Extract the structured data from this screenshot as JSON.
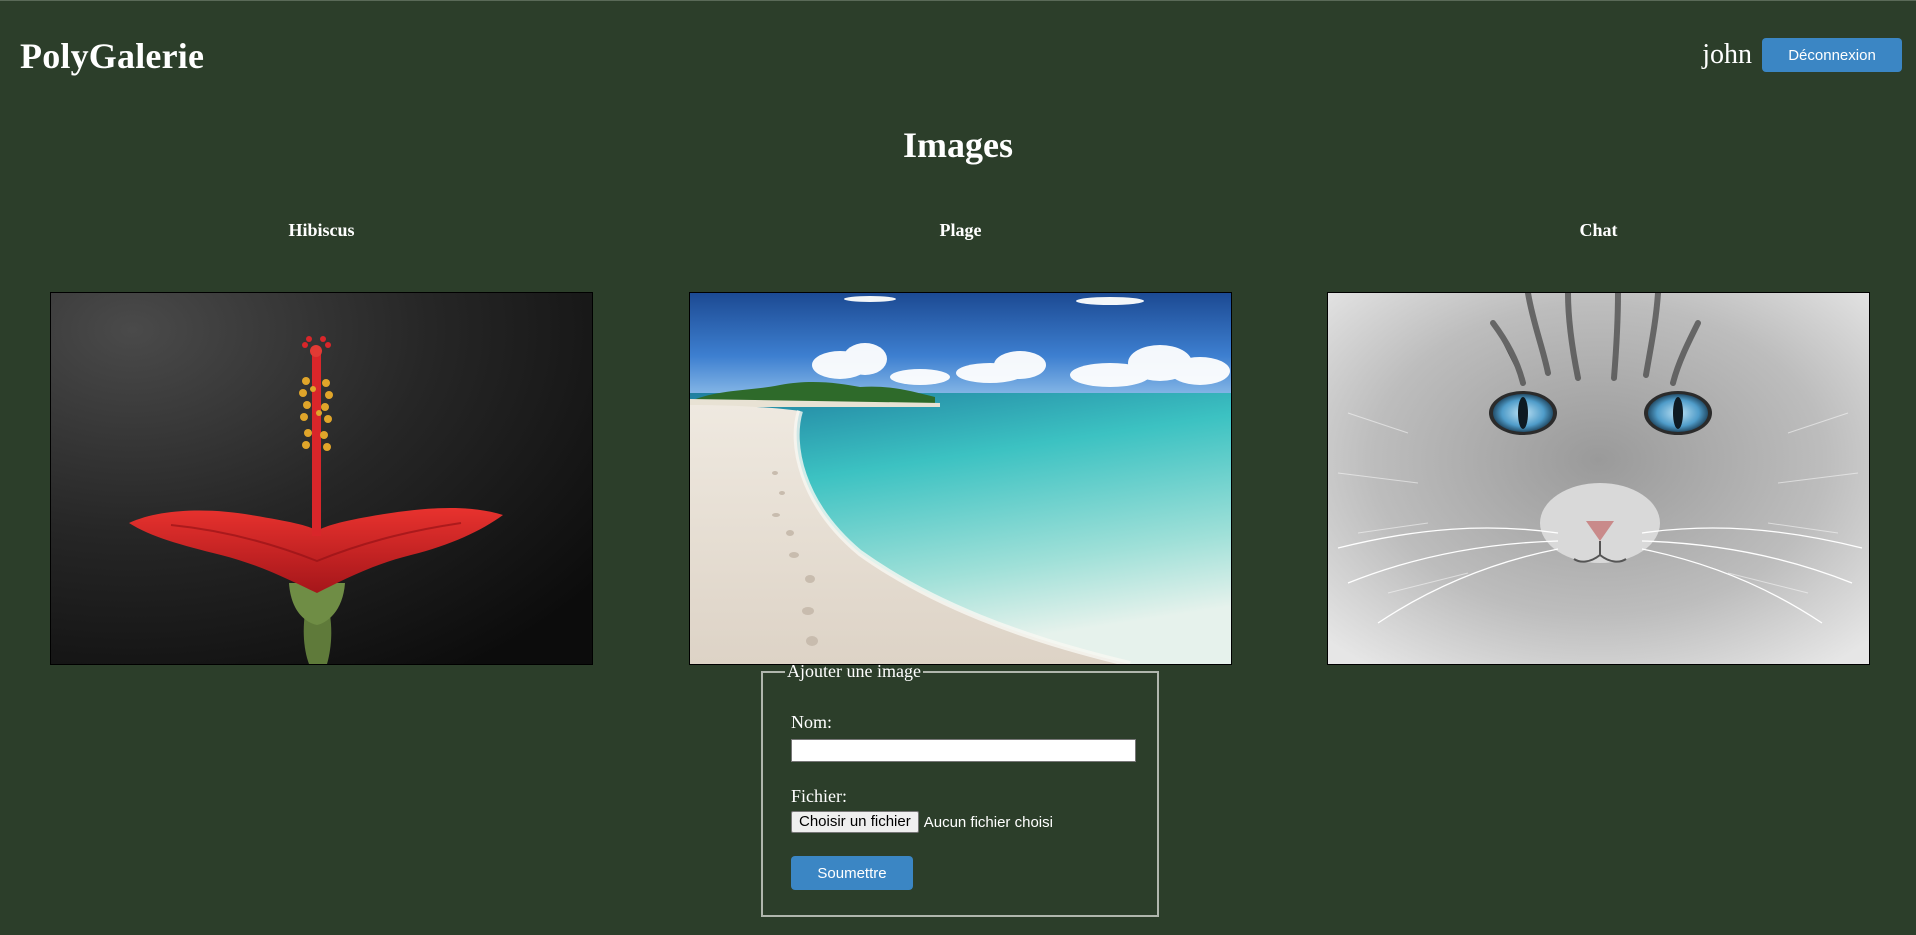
{
  "header": {
    "brand": "PolyGalerie",
    "username": "john",
    "logout_label": "Déconnexion"
  },
  "page": {
    "title": "Images"
  },
  "gallery": [
    {
      "title": "Hibiscus",
      "image": "hibiscus-photo"
    },
    {
      "title": "Plage",
      "image": "beach-photo"
    },
    {
      "title": "Chat",
      "image": "cat-photo"
    }
  ],
  "upload_form": {
    "legend": "Ajouter une image",
    "name_label": "Nom:",
    "name_value": "",
    "file_label": "Fichier:",
    "file_button": "Choisir un fichier",
    "file_status": "Aucun fichier choisi",
    "submit_label": "Soumettre"
  },
  "colors": {
    "background": "#2c3e2a",
    "accent": "#3b86c4",
    "text": "#ffffff"
  }
}
